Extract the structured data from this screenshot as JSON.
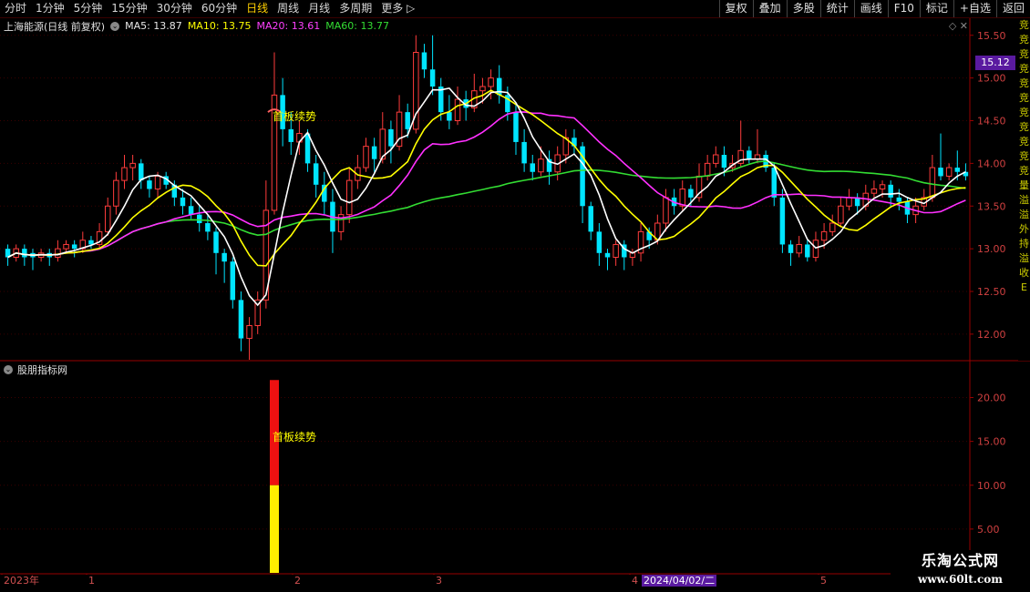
{
  "toolbar": {
    "periods": [
      "分时",
      "1分钟",
      "5分钟",
      "15分钟",
      "30分钟",
      "60分钟",
      "日线",
      "周线",
      "月线",
      "多周期",
      "更多"
    ],
    "active_period": "日线",
    "buttons": [
      "复权",
      "叠加",
      "多股",
      "统计",
      "画线",
      "F10",
      "标记",
      "+自选",
      "返回"
    ]
  },
  "stock": {
    "name": "上海能源(日线 前复权)",
    "ma5_label": "MA5: 13.87",
    "ma10_label": "MA10: 13.75",
    "ma20_label": "MA20: 13.61",
    "ma60_label": "MA60: 13.77"
  },
  "current_price_tag": "15.12",
  "annotation_main": "首板续势",
  "indicator": {
    "title": "股朋指标网",
    "annotation": "首板续势",
    "y_ticks": [
      "20.00",
      "15.00",
      "10.00",
      "5.00"
    ]
  },
  "date_axis": {
    "labels": [
      "2023年",
      "1",
      "2",
      "3",
      "4",
      "5"
    ],
    "highlight": "2024/04/02/二"
  },
  "side_strip_chars": [
    "竞",
    "竞",
    "竞",
    "竞",
    "竞",
    "竞",
    "竞",
    "竞",
    "竞",
    "竞",
    "竞",
    "量",
    "溢",
    "溢",
    "外",
    "持",
    "溢",
    "收",
    "E"
  ],
  "watermark": {
    "title": "乐淘公式网",
    "url": "www.60lt.com"
  },
  "colors": {
    "up": "#ff3c3c",
    "down": "#00e5ff",
    "ma5": "#ffffff",
    "ma10": "#ffff00",
    "ma20": "#ff30ff",
    "ma60": "#33dd33",
    "axis": "#990000",
    "tag": "#5a1aa0"
  },
  "chart_data": {
    "type": "candlestick",
    "y_axis_ticks": [
      15.5,
      15.0,
      14.5,
      14.0,
      13.5,
      13.0,
      12.5,
      12.0
    ],
    "ylim": [
      11.7,
      15.7
    ],
    "candles": [
      [
        13.0,
        12.9,
        13.05,
        12.8
      ],
      [
        12.9,
        13.0,
        13.05,
        12.85
      ],
      [
        13.0,
        12.9,
        13.05,
        12.8
      ],
      [
        12.95,
        12.9,
        13.0,
        12.75
      ],
      [
        12.9,
        12.95,
        13.0,
        12.85
      ],
      [
        12.95,
        12.9,
        13.0,
        12.8
      ],
      [
        12.9,
        13.0,
        13.1,
        12.85
      ],
      [
        13.0,
        13.05,
        13.1,
        12.95
      ],
      [
        13.05,
        13.0,
        13.1,
        12.9
      ],
      [
        13.0,
        13.1,
        13.2,
        12.95
      ],
      [
        13.1,
        13.05,
        13.15,
        13.0
      ],
      [
        13.05,
        13.2,
        13.3,
        13.0
      ],
      [
        13.2,
        13.5,
        13.6,
        13.15
      ],
      [
        13.5,
        13.8,
        13.9,
        13.4
      ],
      [
        13.8,
        13.95,
        14.1,
        13.7
      ],
      [
        13.95,
        14.0,
        14.1,
        13.8
      ],
      [
        14.0,
        13.8,
        14.05,
        13.7
      ],
      [
        13.8,
        13.7,
        13.85,
        13.6
      ],
      [
        13.7,
        13.85,
        13.9,
        13.6
      ],
      [
        13.85,
        13.75,
        13.9,
        13.7
      ],
      [
        13.75,
        13.6,
        13.8,
        13.5
      ],
      [
        13.6,
        13.5,
        13.7,
        13.4
      ],
      [
        13.5,
        13.4,
        13.6,
        13.35
      ],
      [
        13.4,
        13.3,
        13.5,
        13.2
      ],
      [
        13.3,
        13.2,
        13.4,
        13.1
      ],
      [
        13.2,
        12.95,
        13.25,
        12.7
      ],
      [
        12.95,
        12.85,
        13.0,
        12.6
      ],
      [
        12.85,
        12.4,
        12.9,
        12.3
      ],
      [
        12.4,
        11.95,
        12.5,
        11.8
      ],
      [
        11.95,
        12.1,
        12.2,
        11.7
      ],
      [
        12.1,
        12.4,
        12.5,
        12.0
      ],
      [
        12.4,
        13.45,
        13.8,
        12.3
      ],
      [
        13.45,
        14.8,
        15.3,
        13.4
      ],
      [
        14.8,
        14.4,
        15.0,
        14.2
      ],
      [
        14.4,
        14.25,
        14.6,
        14.1
      ],
      [
        14.25,
        14.35,
        14.5,
        14.1
      ],
      [
        14.35,
        14.0,
        14.4,
        13.9
      ],
      [
        14.0,
        13.75,
        14.1,
        13.6
      ],
      [
        13.75,
        13.55,
        13.9,
        13.4
      ],
      [
        13.55,
        13.2,
        13.7,
        12.95
      ],
      [
        13.2,
        13.4,
        13.5,
        13.1
      ],
      [
        13.4,
        13.8,
        13.95,
        13.3
      ],
      [
        13.8,
        13.95,
        14.1,
        13.7
      ],
      [
        13.95,
        14.2,
        14.3,
        13.9
      ],
      [
        14.2,
        14.05,
        14.3,
        13.9
      ],
      [
        14.05,
        14.4,
        14.6,
        14.0
      ],
      [
        14.4,
        14.2,
        14.5,
        14.0
      ],
      [
        14.2,
        14.6,
        14.8,
        14.15
      ],
      [
        14.6,
        14.4,
        14.7,
        14.3
      ],
      [
        14.4,
        15.3,
        15.5,
        14.35
      ],
      [
        15.3,
        15.1,
        15.4,
        15.0
      ],
      [
        15.1,
        14.9,
        15.5,
        14.8
      ],
      [
        14.9,
        14.6,
        15.0,
        14.5
      ],
      [
        14.6,
        14.5,
        14.8,
        14.4
      ],
      [
        14.5,
        14.75,
        14.9,
        14.45
      ],
      [
        14.75,
        14.65,
        14.85,
        14.5
      ],
      [
        14.65,
        14.85,
        15.05,
        14.6
      ],
      [
        14.85,
        14.9,
        15.0,
        14.7
      ],
      [
        14.9,
        15.0,
        15.1,
        14.75
      ],
      [
        15.0,
        14.8,
        15.15,
        14.7
      ],
      [
        14.8,
        14.6,
        14.9,
        14.5
      ],
      [
        14.6,
        14.25,
        14.7,
        14.1
      ],
      [
        14.25,
        14.0,
        14.4,
        13.9
      ],
      [
        14.0,
        13.9,
        14.1,
        13.8
      ],
      [
        13.9,
        14.05,
        14.2,
        13.85
      ],
      [
        14.05,
        13.9,
        14.15,
        13.75
      ],
      [
        13.9,
        14.1,
        14.2,
        13.8
      ],
      [
        14.1,
        14.3,
        14.4,
        14.0
      ],
      [
        14.3,
        14.2,
        14.4,
        14.1
      ],
      [
        14.2,
        13.5,
        14.25,
        13.3
      ],
      [
        13.5,
        13.2,
        13.55,
        13.1
      ],
      [
        13.2,
        12.95,
        13.3,
        12.8
      ],
      [
        12.95,
        12.9,
        13.0,
        12.75
      ],
      [
        12.9,
        13.05,
        13.1,
        12.8
      ],
      [
        13.05,
        12.9,
        13.1,
        12.75
      ],
      [
        12.9,
        12.95,
        13.0,
        12.8
      ],
      [
        12.95,
        13.2,
        13.3,
        12.85
      ],
      [
        13.2,
        13.1,
        13.25,
        13.0
      ],
      [
        13.1,
        13.3,
        13.4,
        13.05
      ],
      [
        13.3,
        13.6,
        13.7,
        13.2
      ],
      [
        13.6,
        13.5,
        13.7,
        13.4
      ],
      [
        13.5,
        13.7,
        13.8,
        13.45
      ],
      [
        13.7,
        13.6,
        13.75,
        13.5
      ],
      [
        13.6,
        13.85,
        14.0,
        13.55
      ],
      [
        13.85,
        14.0,
        14.1,
        13.8
      ],
      [
        14.0,
        14.1,
        14.2,
        13.95
      ],
      [
        14.1,
        13.95,
        14.2,
        13.85
      ],
      [
        13.95,
        14.0,
        14.1,
        13.9
      ],
      [
        14.0,
        14.15,
        14.5,
        13.95
      ],
      [
        14.15,
        14.05,
        14.2,
        14.0
      ],
      [
        14.05,
        14.1,
        14.4,
        14.0
      ],
      [
        14.1,
        13.95,
        14.15,
        13.9
      ],
      [
        13.95,
        13.6,
        14.0,
        13.5
      ],
      [
        13.6,
        13.05,
        13.7,
        12.95
      ],
      [
        13.05,
        12.95,
        13.1,
        12.8
      ],
      [
        12.95,
        13.05,
        13.15,
        12.9
      ],
      [
        13.05,
        12.9,
        13.1,
        12.85
      ],
      [
        12.9,
        13.1,
        13.2,
        12.85
      ],
      [
        13.1,
        13.2,
        13.3,
        13.0
      ],
      [
        13.2,
        13.3,
        13.4,
        13.15
      ],
      [
        13.3,
        13.5,
        13.6,
        13.25
      ],
      [
        13.5,
        13.6,
        13.7,
        13.45
      ],
      [
        13.6,
        13.5,
        13.65,
        13.4
      ],
      [
        13.5,
        13.65,
        13.75,
        13.45
      ],
      [
        13.65,
        13.7,
        13.8,
        13.6
      ],
      [
        13.7,
        13.75,
        13.8,
        13.6
      ],
      [
        13.75,
        13.6,
        13.8,
        13.5
      ],
      [
        13.6,
        13.55,
        13.7,
        13.45
      ],
      [
        13.55,
        13.4,
        13.6,
        13.3
      ],
      [
        13.4,
        13.5,
        13.6,
        13.3
      ],
      [
        13.5,
        13.6,
        13.7,
        13.45
      ],
      [
        13.6,
        13.95,
        14.1,
        13.55
      ],
      [
        13.95,
        13.85,
        14.35,
        13.8
      ],
      [
        13.85,
        13.95,
        14.0,
        13.8
      ],
      [
        13.95,
        13.9,
        14.15,
        13.8
      ],
      [
        13.9,
        13.85,
        14.0,
        13.8
      ]
    ],
    "indicator_bar": {
      "total": 22,
      "yellow_part": 10,
      "label": "首板续势"
    }
  }
}
